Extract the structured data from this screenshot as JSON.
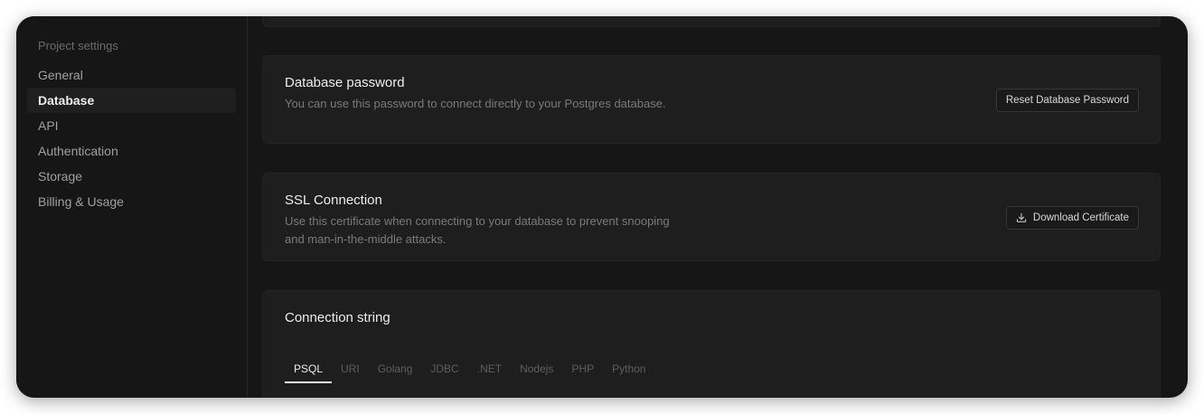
{
  "sidebar": {
    "heading": "Project settings",
    "items": [
      {
        "label": "General",
        "active": false
      },
      {
        "label": "Database",
        "active": true
      },
      {
        "label": "API",
        "active": false
      },
      {
        "label": "Authentication",
        "active": false
      },
      {
        "label": "Storage",
        "active": false
      },
      {
        "label": "Billing & Usage",
        "active": false
      }
    ]
  },
  "password_card": {
    "title": "Database password",
    "description": "You can use this password to connect directly to your Postgres database.",
    "button_label": "Reset Database Password"
  },
  "ssl_card": {
    "title": "SSL Connection",
    "description": "Use this certificate when connecting to your database to prevent snooping and man-in-the-middle attacks.",
    "button_label": "Download Certificate",
    "button_icon": "download-icon"
  },
  "connection_card": {
    "title": "Connection string",
    "tabs": [
      "PSQL",
      "URI",
      "Golang",
      "JDBC",
      ".NET",
      "Nodejs",
      "PHP",
      "Python"
    ],
    "active_tab": "PSQL"
  }
}
